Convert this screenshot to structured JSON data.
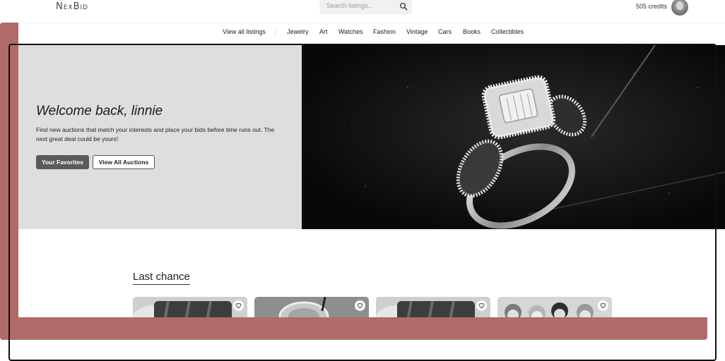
{
  "header": {
    "logo": "NexBid",
    "search_placeholder": "Search listings...",
    "credits": "505 credits"
  },
  "nav": {
    "items": [
      "View all listings",
      "Jewelry",
      "Art",
      "Watches",
      "Fashion",
      "Vintage",
      "Cars",
      "Books",
      "Collectibles"
    ]
  },
  "hero": {
    "title": "Welcome back, linnie",
    "text": "Find new auctions that match your interests and place your bids before time runs out. The next great deal could be yours!",
    "favorites_button": "Your Favorites",
    "all_auctions_button": "View All Auctions"
  },
  "last_chance": {
    "title": "Last chance"
  },
  "colors": {
    "frame": "#b06b69",
    "hero_left_bg": "#dedede",
    "primary_button": "#5a5a5a"
  }
}
